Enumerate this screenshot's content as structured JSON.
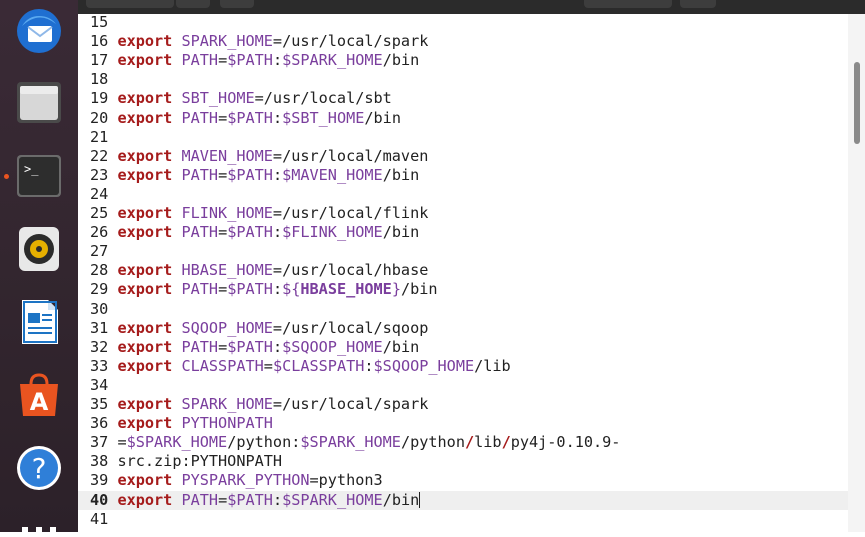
{
  "dock": {
    "items": [
      {
        "name": "thunderbird-icon",
        "running": false
      },
      {
        "name": "files-icon",
        "running": false
      },
      {
        "name": "terminal-icon",
        "running": true
      },
      {
        "name": "rhythmbox-icon",
        "running": false
      },
      {
        "name": "libreoffice-writer-icon",
        "running": false
      },
      {
        "name": "ubuntu-software-icon",
        "running": false
      },
      {
        "name": "help-icon",
        "running": false
      },
      {
        "name": "show-apps-icon",
        "running": false
      }
    ],
    "terminal_prompt_glyph": ">_",
    "help_glyph": "?",
    "software_glyph": "A"
  },
  "colors": {
    "keyword": "#a51b1b",
    "variable": "#7a3e9d",
    "text": "#222222",
    "accent": "#e95420"
  },
  "editor": {
    "lines": [
      {
        "num": "15",
        "segments": []
      },
      {
        "num": "16",
        "segments": [
          {
            "t": "export",
            "c": "kw"
          },
          {
            "t": " ",
            "c": "plain"
          },
          {
            "t": "SPARK_HOME",
            "c": "var"
          },
          {
            "t": "=/usr/local/spark",
            "c": "plain"
          }
        ]
      },
      {
        "num": "17",
        "segments": [
          {
            "t": "export",
            "c": "kw"
          },
          {
            "t": " ",
            "c": "plain"
          },
          {
            "t": "PATH",
            "c": "var"
          },
          {
            "t": "=",
            "c": "plain"
          },
          {
            "t": "$PATH",
            "c": "var"
          },
          {
            "t": ":",
            "c": "plain"
          },
          {
            "t": "$SPARK_HOME",
            "c": "var"
          },
          {
            "t": "/bin",
            "c": "plain"
          }
        ]
      },
      {
        "num": "18",
        "segments": []
      },
      {
        "num": "19",
        "segments": [
          {
            "t": "export",
            "c": "kw"
          },
          {
            "t": " ",
            "c": "plain"
          },
          {
            "t": "SBT_HOME",
            "c": "var"
          },
          {
            "t": "=/usr/local/sbt",
            "c": "plain"
          }
        ]
      },
      {
        "num": "20",
        "segments": [
          {
            "t": "export",
            "c": "kw"
          },
          {
            "t": " ",
            "c": "plain"
          },
          {
            "t": "PATH",
            "c": "var"
          },
          {
            "t": "=",
            "c": "plain"
          },
          {
            "t": "$PATH",
            "c": "var"
          },
          {
            "t": ":",
            "c": "plain"
          },
          {
            "t": "$SBT_HOME",
            "c": "var"
          },
          {
            "t": "/bin",
            "c": "plain"
          }
        ]
      },
      {
        "num": "21",
        "segments": []
      },
      {
        "num": "22",
        "segments": [
          {
            "t": "export",
            "c": "kw"
          },
          {
            "t": " ",
            "c": "plain"
          },
          {
            "t": "MAVEN_HOME",
            "c": "var"
          },
          {
            "t": "=/usr/local/maven",
            "c": "plain"
          }
        ]
      },
      {
        "num": "23",
        "segments": [
          {
            "t": "export",
            "c": "kw"
          },
          {
            "t": " ",
            "c": "plain"
          },
          {
            "t": "PATH",
            "c": "var"
          },
          {
            "t": "=",
            "c": "plain"
          },
          {
            "t": "$PATH",
            "c": "var"
          },
          {
            "t": ":",
            "c": "plain"
          },
          {
            "t": "$MAVEN_HOME",
            "c": "var"
          },
          {
            "t": "/bin",
            "c": "plain"
          }
        ]
      },
      {
        "num": "24",
        "segments": []
      },
      {
        "num": "25",
        "segments": [
          {
            "t": "export",
            "c": "kw"
          },
          {
            "t": " ",
            "c": "plain"
          },
          {
            "t": "FLINK_HOME",
            "c": "var"
          },
          {
            "t": "=/usr/local/flink",
            "c": "plain"
          }
        ]
      },
      {
        "num": "26",
        "segments": [
          {
            "t": "export",
            "c": "kw"
          },
          {
            "t": " ",
            "c": "plain"
          },
          {
            "t": "PATH",
            "c": "var"
          },
          {
            "t": "=",
            "c": "plain"
          },
          {
            "t": "$PATH",
            "c": "var"
          },
          {
            "t": ":",
            "c": "plain"
          },
          {
            "t": "$FLINK_HOME",
            "c": "var"
          },
          {
            "t": "/bin",
            "c": "plain"
          }
        ]
      },
      {
        "num": "27",
        "segments": []
      },
      {
        "num": "28",
        "segments": [
          {
            "t": "export",
            "c": "kw"
          },
          {
            "t": " ",
            "c": "plain"
          },
          {
            "t": "HBASE_HOME",
            "c": "var"
          },
          {
            "t": "=/usr/local/hbase",
            "c": "plain"
          }
        ]
      },
      {
        "num": "29",
        "segments": [
          {
            "t": "export",
            "c": "kw"
          },
          {
            "t": " ",
            "c": "plain"
          },
          {
            "t": "PATH",
            "c": "var"
          },
          {
            "t": "=",
            "c": "plain"
          },
          {
            "t": "$PATH",
            "c": "var"
          },
          {
            "t": ":",
            "c": "plain"
          },
          {
            "t": "${",
            "c": "var"
          },
          {
            "t": "HBASE_HOME",
            "c": "var bold"
          },
          {
            "t": "}",
            "c": "var"
          },
          {
            "t": "/bin",
            "c": "plain"
          }
        ]
      },
      {
        "num": "30",
        "segments": []
      },
      {
        "num": "31",
        "segments": [
          {
            "t": "export",
            "c": "kw"
          },
          {
            "t": " ",
            "c": "plain"
          },
          {
            "t": "SQOOP_HOME",
            "c": "var"
          },
          {
            "t": "=/usr/local/sqoop",
            "c": "plain"
          }
        ]
      },
      {
        "num": "32",
        "segments": [
          {
            "t": "export",
            "c": "kw"
          },
          {
            "t": " ",
            "c": "plain"
          },
          {
            "t": "PATH",
            "c": "var"
          },
          {
            "t": "=",
            "c": "plain"
          },
          {
            "t": "$PATH",
            "c": "var"
          },
          {
            "t": ":",
            "c": "plain"
          },
          {
            "t": "$SQOOP_HOME",
            "c": "var"
          },
          {
            "t": "/bin",
            "c": "plain"
          }
        ]
      },
      {
        "num": "33",
        "segments": [
          {
            "t": "export",
            "c": "kw"
          },
          {
            "t": " ",
            "c": "plain"
          },
          {
            "t": "CLASSPATH",
            "c": "var"
          },
          {
            "t": "=",
            "c": "plain"
          },
          {
            "t": "$CLASSPATH",
            "c": "var"
          },
          {
            "t": ":",
            "c": "plain"
          },
          {
            "t": "$SQOOP_HOME",
            "c": "var"
          },
          {
            "t": "/lib",
            "c": "plain"
          }
        ]
      },
      {
        "num": "34",
        "segments": []
      },
      {
        "num": "35",
        "segments": [
          {
            "t": "export",
            "c": "kw"
          },
          {
            "t": " ",
            "c": "plain"
          },
          {
            "t": "SPARK_HOME",
            "c": "var"
          },
          {
            "t": "=/usr/local/spark",
            "c": "plain"
          }
        ]
      },
      {
        "num": "36",
        "segments": [
          {
            "t": "export",
            "c": "kw"
          },
          {
            "t": " ",
            "c": "plain"
          },
          {
            "t": "PYTHONPATH",
            "c": "var"
          }
        ]
      },
      {
        "num": "37",
        "segments": [
          {
            "t": "=",
            "c": "plain"
          },
          {
            "t": "$SPARK_HOME",
            "c": "var"
          },
          {
            "t": "/python:",
            "c": "plain"
          },
          {
            "t": "$SPARK_HOME",
            "c": "var"
          },
          {
            "t": "/python",
            "c": "plain"
          },
          {
            "t": "/",
            "c": "kw"
          },
          {
            "t": "lib",
            "c": "plain"
          },
          {
            "t": "/",
            "c": "kw"
          },
          {
            "t": "py4j-0.10.9-",
            "c": "plain"
          }
        ]
      },
      {
        "num": "38",
        "segments": [
          {
            "t": "src.zip:PYTHONPATH",
            "c": "plain"
          }
        ]
      },
      {
        "num": "39",
        "segments": [
          {
            "t": "export",
            "c": "kw"
          },
          {
            "t": " ",
            "c": "plain"
          },
          {
            "t": "PYSPARK_PYTHON",
            "c": "var"
          },
          {
            "t": "=python3",
            "c": "plain"
          }
        ]
      },
      {
        "num": "40",
        "current": true,
        "segments": [
          {
            "t": "export",
            "c": "kw"
          },
          {
            "t": " ",
            "c": "plain"
          },
          {
            "t": "PATH",
            "c": "var"
          },
          {
            "t": "=",
            "c": "plain"
          },
          {
            "t": "$PATH",
            "c": "var"
          },
          {
            "t": ":",
            "c": "plain"
          },
          {
            "t": "$SPARK_HOME",
            "c": "var"
          },
          {
            "t": "/bin",
            "c": "plain"
          }
        ]
      },
      {
        "num": "41",
        "segments": []
      }
    ]
  }
}
